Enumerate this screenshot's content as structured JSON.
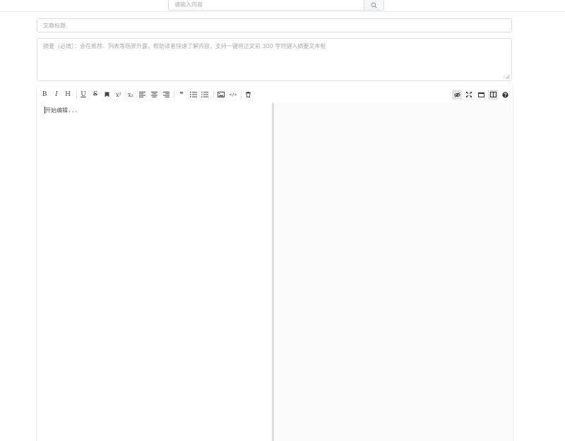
{
  "search": {
    "placeholder": "请输入内容",
    "button_icon": "search-icon"
  },
  "article": {
    "title_placeholder": "文章标题",
    "summary_placeholder": "摘要（必填）：会在推荐、列表等场景外露，帮助读者快速了解内容，支持一键将正文前 300 字符键入摘要文本框"
  },
  "toolbar": {
    "left": [
      {
        "icon": "bold-icon",
        "glyph": "B"
      },
      {
        "icon": "italic-icon",
        "glyph": "I"
      },
      {
        "icon": "heading-icon",
        "glyph": "H"
      },
      {
        "icon": "underline-icon",
        "glyph": "U"
      },
      {
        "icon": "strikethrough-icon",
        "glyph": "S"
      },
      {
        "icon": "mark-icon",
        "glyph": ""
      },
      {
        "icon": "superscript-icon",
        "glyph": "x²"
      },
      {
        "icon": "subscript-icon",
        "glyph": "x₂"
      },
      {
        "icon": "align-left-icon",
        "glyph": ""
      },
      {
        "icon": "align-center-icon",
        "glyph": ""
      },
      {
        "icon": "align-right-icon",
        "glyph": ""
      },
      {
        "icon": "quote-icon",
        "glyph": "❝"
      },
      {
        "icon": "ordered-list-icon",
        "glyph": ""
      },
      {
        "icon": "unordered-list-icon",
        "glyph": ""
      },
      {
        "icon": "image-icon",
        "glyph": ""
      },
      {
        "icon": "code-icon",
        "glyph": "</>"
      },
      {
        "icon": "trash-icon",
        "glyph": ""
      }
    ],
    "right": [
      {
        "icon": "preview-toggle-icon",
        "active": true
      },
      {
        "icon": "fullscreen-icon",
        "active": false
      },
      {
        "icon": "window-icon",
        "active": false
      },
      {
        "icon": "split-view-icon",
        "active": true
      },
      {
        "icon": "help-icon",
        "active": false
      }
    ]
  },
  "editor": {
    "placeholder": "开始编辑..."
  }
}
